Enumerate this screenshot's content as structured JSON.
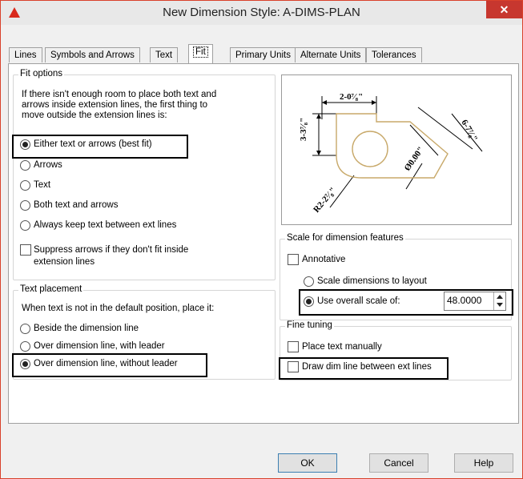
{
  "window": {
    "title": "New Dimension Style: A-DIMS-PLAN",
    "close": "✕"
  },
  "tabs": [
    "Lines",
    "Symbols and Arrows",
    "Text",
    "Fit",
    "Primary Units",
    "Alternate Units",
    "Tolerances"
  ],
  "fit_options": {
    "legend": "Fit options",
    "description": [
      "If there isn't enough room to place both text and",
      "arrows inside extension lines, the first thing to",
      "move outside the extension lines is:"
    ],
    "choices": [
      "Either text or arrows (best fit)",
      "Arrows",
      "Text",
      "Both text and arrows",
      "Always keep text between ext lines"
    ],
    "selected": "Either text or arrows (best fit)",
    "suppress_arrows": [
      "Suppress arrows if they don't fit inside",
      "extension lines"
    ]
  },
  "text_placement": {
    "legend": "Text placement",
    "description": "When text is not in the default position, place it:",
    "choices": [
      "Beside the dimension line",
      "Over dimension line, with leader",
      "Over dimension line, without leader"
    ],
    "selected": "Over dimension line, without leader"
  },
  "preview": {
    "dim_top": "2-0⁷⁄₈\"",
    "dim_left": "3-3⁷⁄₈\"",
    "dim_right": "6-7⁷⁄₈\"",
    "dim_diameter": "Ø0.00\"",
    "dim_radius": "R2-2⁷⁄₈\""
  },
  "scale": {
    "legend": "Scale for dimension features",
    "annotative": "Annotative",
    "scale_to_layout": "Scale dimensions to layout",
    "use_overall": "Use overall scale of:",
    "value": "48.0000"
  },
  "fine_tuning": {
    "legend": "Fine tuning",
    "place_manually": "Place text manually",
    "draw_dim_line": "Draw dim line between ext lines"
  },
  "buttons": {
    "ok": "OK",
    "cancel": "Cancel",
    "help": "Help"
  },
  "colors": {
    "accent_close": "#c7372f",
    "drawing_outline": "#c8a96a"
  }
}
